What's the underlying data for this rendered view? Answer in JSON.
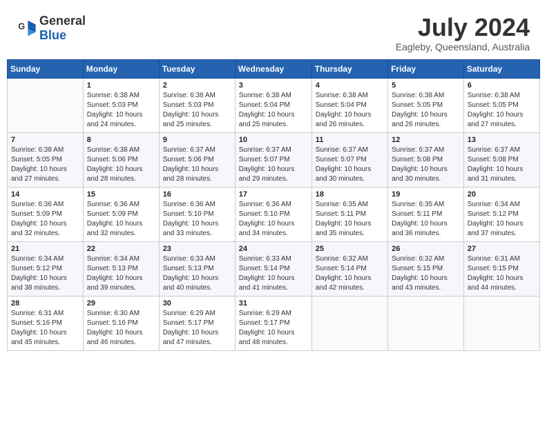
{
  "header": {
    "logo_general": "General",
    "logo_blue": "Blue",
    "month": "July 2024",
    "location": "Eagleby, Queensland, Australia"
  },
  "days_of_week": [
    "Sunday",
    "Monday",
    "Tuesday",
    "Wednesday",
    "Thursday",
    "Friday",
    "Saturday"
  ],
  "weeks": [
    [
      {
        "day": "",
        "info": ""
      },
      {
        "day": "1",
        "info": "Sunrise: 6:38 AM\nSunset: 5:03 PM\nDaylight: 10 hours\nand 24 minutes."
      },
      {
        "day": "2",
        "info": "Sunrise: 6:38 AM\nSunset: 5:03 PM\nDaylight: 10 hours\nand 25 minutes."
      },
      {
        "day": "3",
        "info": "Sunrise: 6:38 AM\nSunset: 5:04 PM\nDaylight: 10 hours\nand 25 minutes."
      },
      {
        "day": "4",
        "info": "Sunrise: 6:38 AM\nSunset: 5:04 PM\nDaylight: 10 hours\nand 26 minutes."
      },
      {
        "day": "5",
        "info": "Sunrise: 6:38 AM\nSunset: 5:05 PM\nDaylight: 10 hours\nand 26 minutes."
      },
      {
        "day": "6",
        "info": "Sunrise: 6:38 AM\nSunset: 5:05 PM\nDaylight: 10 hours\nand 27 minutes."
      }
    ],
    [
      {
        "day": "7",
        "info": "Sunrise: 6:38 AM\nSunset: 5:05 PM\nDaylight: 10 hours\nand 27 minutes."
      },
      {
        "day": "8",
        "info": "Sunrise: 6:38 AM\nSunset: 5:06 PM\nDaylight: 10 hours\nand 28 minutes."
      },
      {
        "day": "9",
        "info": "Sunrise: 6:37 AM\nSunset: 5:06 PM\nDaylight: 10 hours\nand 28 minutes."
      },
      {
        "day": "10",
        "info": "Sunrise: 6:37 AM\nSunset: 5:07 PM\nDaylight: 10 hours\nand 29 minutes."
      },
      {
        "day": "11",
        "info": "Sunrise: 6:37 AM\nSunset: 5:07 PM\nDaylight: 10 hours\nand 30 minutes."
      },
      {
        "day": "12",
        "info": "Sunrise: 6:37 AM\nSunset: 5:08 PM\nDaylight: 10 hours\nand 30 minutes."
      },
      {
        "day": "13",
        "info": "Sunrise: 6:37 AM\nSunset: 5:08 PM\nDaylight: 10 hours\nand 31 minutes."
      }
    ],
    [
      {
        "day": "14",
        "info": "Sunrise: 6:36 AM\nSunset: 5:09 PM\nDaylight: 10 hours\nand 32 minutes."
      },
      {
        "day": "15",
        "info": "Sunrise: 6:36 AM\nSunset: 5:09 PM\nDaylight: 10 hours\nand 32 minutes."
      },
      {
        "day": "16",
        "info": "Sunrise: 6:36 AM\nSunset: 5:10 PM\nDaylight: 10 hours\nand 33 minutes."
      },
      {
        "day": "17",
        "info": "Sunrise: 6:36 AM\nSunset: 5:10 PM\nDaylight: 10 hours\nand 34 minutes."
      },
      {
        "day": "18",
        "info": "Sunrise: 6:35 AM\nSunset: 5:11 PM\nDaylight: 10 hours\nand 35 minutes."
      },
      {
        "day": "19",
        "info": "Sunrise: 6:35 AM\nSunset: 5:11 PM\nDaylight: 10 hours\nand 36 minutes."
      },
      {
        "day": "20",
        "info": "Sunrise: 6:34 AM\nSunset: 5:12 PM\nDaylight: 10 hours\nand 37 minutes."
      }
    ],
    [
      {
        "day": "21",
        "info": "Sunrise: 6:34 AM\nSunset: 5:12 PM\nDaylight: 10 hours\nand 38 minutes."
      },
      {
        "day": "22",
        "info": "Sunrise: 6:34 AM\nSunset: 5:13 PM\nDaylight: 10 hours\nand 39 minutes."
      },
      {
        "day": "23",
        "info": "Sunrise: 6:33 AM\nSunset: 5:13 PM\nDaylight: 10 hours\nand 40 minutes."
      },
      {
        "day": "24",
        "info": "Sunrise: 6:33 AM\nSunset: 5:14 PM\nDaylight: 10 hours\nand 41 minutes."
      },
      {
        "day": "25",
        "info": "Sunrise: 6:32 AM\nSunset: 5:14 PM\nDaylight: 10 hours\nand 42 minutes."
      },
      {
        "day": "26",
        "info": "Sunrise: 6:32 AM\nSunset: 5:15 PM\nDaylight: 10 hours\nand 43 minutes."
      },
      {
        "day": "27",
        "info": "Sunrise: 6:31 AM\nSunset: 5:15 PM\nDaylight: 10 hours\nand 44 minutes."
      }
    ],
    [
      {
        "day": "28",
        "info": "Sunrise: 6:31 AM\nSunset: 5:16 PM\nDaylight: 10 hours\nand 45 minutes."
      },
      {
        "day": "29",
        "info": "Sunrise: 6:30 AM\nSunset: 5:16 PM\nDaylight: 10 hours\nand 46 minutes."
      },
      {
        "day": "30",
        "info": "Sunrise: 6:29 AM\nSunset: 5:17 PM\nDaylight: 10 hours\nand 47 minutes."
      },
      {
        "day": "31",
        "info": "Sunrise: 6:29 AM\nSunset: 5:17 PM\nDaylight: 10 hours\nand 48 minutes."
      },
      {
        "day": "",
        "info": ""
      },
      {
        "day": "",
        "info": ""
      },
      {
        "day": "",
        "info": ""
      }
    ]
  ]
}
